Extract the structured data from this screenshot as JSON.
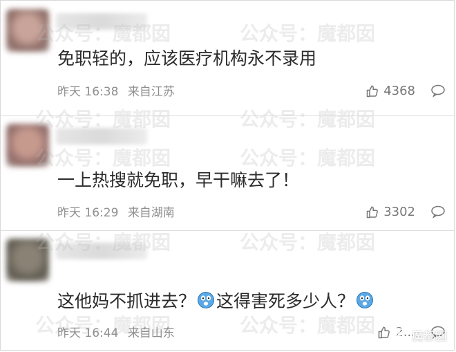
{
  "watermark_text": "公众号：魔都囡",
  "comments": [
    {
      "text": "免职轻的，应该医疗机构永不录用",
      "time": "昨天 16:38",
      "location": "来自江苏",
      "likes": "4368"
    },
    {
      "text": "一上热搜就免职，早干嘛去了！",
      "time": "昨天 16:29",
      "location": "来自湖南",
      "likes": "3302"
    },
    {
      "text_part1": "这他妈不抓进去？",
      "text_part2": "这得害死多少人？",
      "time": "昨天 16:44",
      "location": "来自山东",
      "likes": "2...",
      "corner_mark": "魔都囡"
    }
  ],
  "icons": {
    "like": "thumbs-up-icon",
    "reply": "speech-bubble-icon",
    "emoji": "shocked-emoji-icon"
  },
  "colors": {
    "meta_text": "#8f8f8f",
    "icon_gray": "#777777"
  }
}
